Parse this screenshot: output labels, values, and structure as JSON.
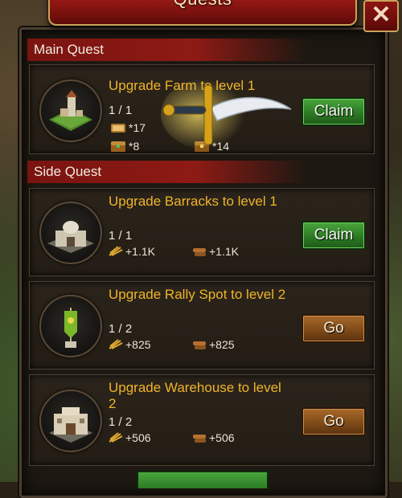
{
  "dialog": {
    "title": "Quests"
  },
  "main_quest": {
    "header": "Main Quest",
    "title": "Upgrade Farm to level 1",
    "progress": "1 / 1",
    "rewards": [
      {
        "icon": "book-icon",
        "text": "*17"
      },
      {
        "icon": "chest-icon",
        "text": "*14"
      },
      {
        "icon": "gem-chest-icon",
        "text": "*8"
      }
    ],
    "button": "Claim"
  },
  "side_quest": {
    "header": "Side Quest",
    "items": [
      {
        "title": "Upgrade Barracks to level 1",
        "progress": "1 / 1",
        "food": "+1.1K",
        "wood": "+1.1K",
        "button": "Claim",
        "building": "barracks"
      },
      {
        "title": "Upgrade Rally Spot to level 2",
        "progress": "1 / 2",
        "food": "+825",
        "wood": "+825",
        "button": "Go",
        "building": "rally-spot"
      },
      {
        "title": "Upgrade Warehouse to level 2",
        "progress": "1 / 2",
        "food": "+506",
        "wood": "+506",
        "button": "Go",
        "building": "warehouse"
      }
    ]
  }
}
